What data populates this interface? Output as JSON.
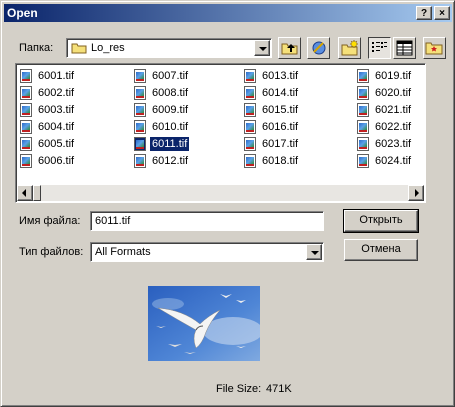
{
  "title": "Open",
  "titlebar_buttons": {
    "help": "?",
    "close": "×"
  },
  "look_in": {
    "label": "Папка:",
    "value": "Lo_res"
  },
  "toolbar": [
    {
      "name": "up-one-level-icon"
    },
    {
      "name": "search-web-icon"
    },
    {
      "name": "create-new-folder-icon"
    },
    {
      "name": "list-view-icon",
      "pressed": true
    },
    {
      "name": "details-view-icon"
    },
    {
      "name": "favorites-folder-icon"
    }
  ],
  "files": {
    "columns": [
      [
        "6001.tif",
        "6002.tif",
        "6003.tif",
        "6004.tif",
        "6005.tif",
        "6006.tif"
      ],
      [
        "6007.tif",
        "6008.tif",
        "6009.tif",
        "6010.tif",
        "6011.tif",
        "6012.tif"
      ],
      [
        "6013.tif",
        "6014.tif",
        "6015.tif",
        "6016.tif",
        "6017.tif",
        "6018.tif"
      ],
      [
        "6019.tif",
        "6020.tif",
        "6021.tif",
        "6022.tif",
        "6023.tif",
        "6024.tif"
      ]
    ],
    "selected": "6011.tif"
  },
  "filename": {
    "label": "Имя файла:",
    "value": "6011.tif"
  },
  "filetype": {
    "label": "Тип файлов:",
    "value": "All Formats"
  },
  "buttons": {
    "open": "Открыть",
    "cancel": "Отмена"
  },
  "file_size": {
    "label": "File Size:",
    "value": "471K"
  }
}
